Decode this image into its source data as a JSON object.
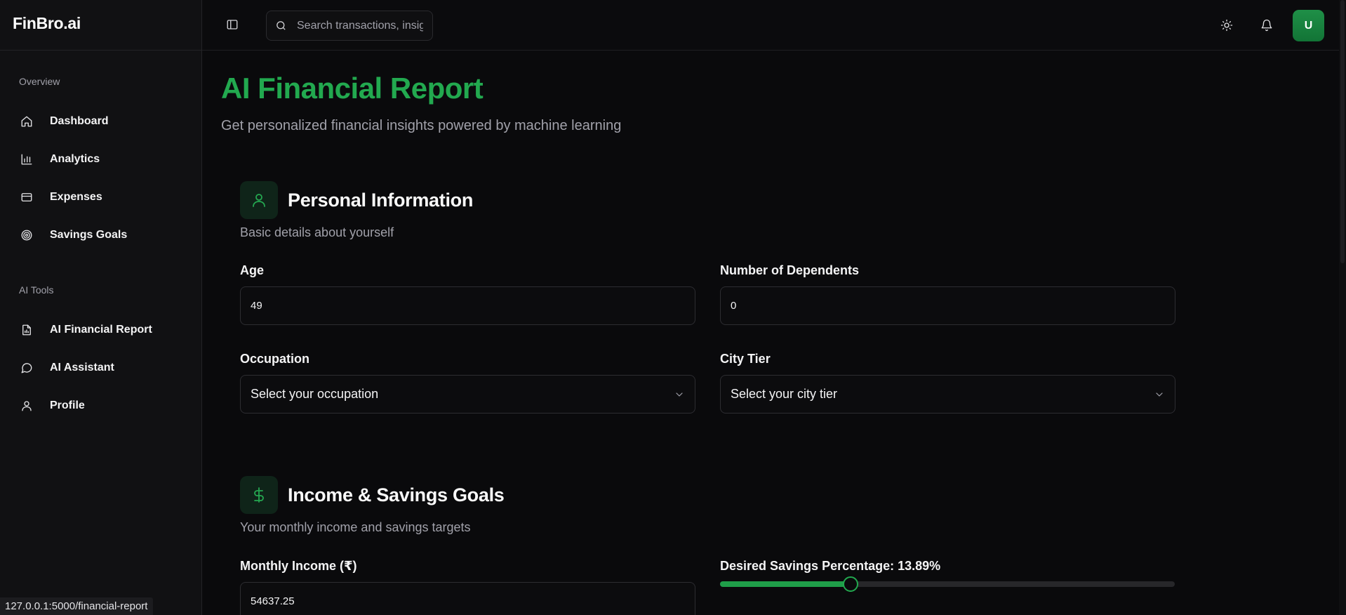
{
  "app": {
    "brand": "FinBro.ai"
  },
  "sidebar": {
    "overview_label": "Overview",
    "ai_tools_label": "AI Tools",
    "overview_items": [
      {
        "label": "Dashboard",
        "icon": "home-icon"
      },
      {
        "label": "Analytics",
        "icon": "bar-chart-icon"
      },
      {
        "label": "Expenses",
        "icon": "credit-card-icon"
      },
      {
        "label": "Savings Goals",
        "icon": "target-icon"
      }
    ],
    "ai_items": [
      {
        "label": "AI Financial Report",
        "icon": "file-chart-icon"
      },
      {
        "label": "AI Assistant",
        "icon": "chat-bubble-icon"
      },
      {
        "label": "Profile",
        "icon": "user-icon"
      }
    ]
  },
  "topbar": {
    "search_placeholder": "Search transactions, insights...",
    "avatar_initial": "U"
  },
  "page": {
    "title": "AI Financial Report",
    "subtitle": "Get personalized financial insights powered by machine learning"
  },
  "personal": {
    "title": "Personal Information",
    "subtitle": "Basic details about yourself",
    "age_label": "Age",
    "age_value": "49",
    "dependents_label": "Number of Dependents",
    "dependents_value": "0",
    "occupation_label": "Occupation",
    "occupation_value": "Select your occupation",
    "city_label": "City Tier",
    "city_value": "Select your city tier"
  },
  "income": {
    "title": "Income & Savings Goals",
    "subtitle": "Your monthly income and savings targets",
    "monthly_income_label": "Monthly Income (₹)",
    "monthly_income_value": "54637.25",
    "savings_label": "Desired Savings Percentage: 13.89%",
    "savings_slider_fraction": 0.2875
  },
  "status_url": "127.0.0.1:5000/financial-report",
  "colors": {
    "accent": "#22a94f",
    "background": "#0a0a0c",
    "sidebar": "#111113"
  }
}
